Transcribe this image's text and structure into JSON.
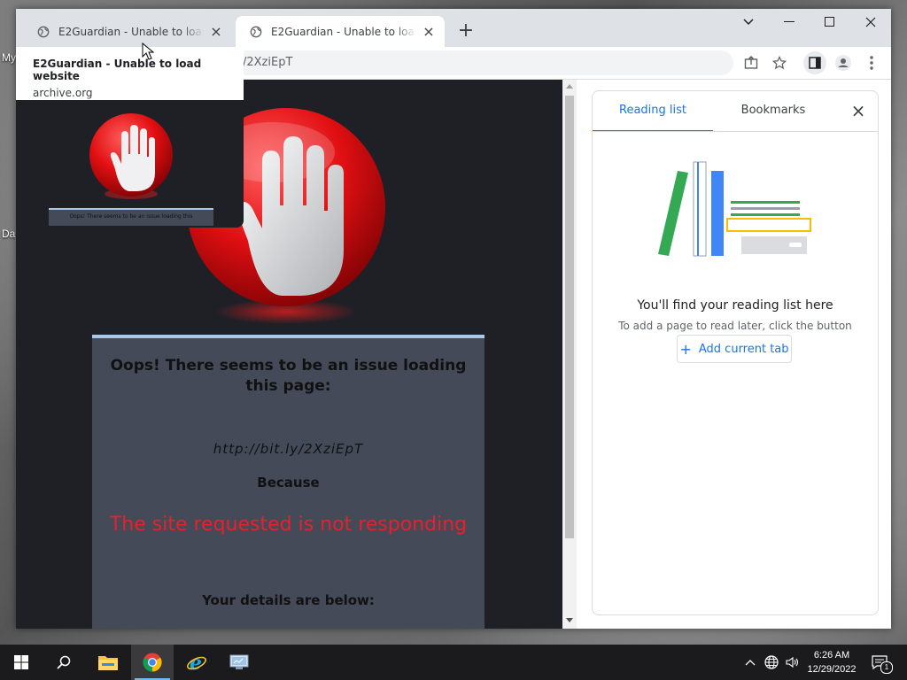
{
  "desktop": {
    "labels": [
      "My",
      "Da"
    ]
  },
  "browser": {
    "tabs": [
      {
        "title": "E2Guardian - Unable to load website",
        "active": false
      },
      {
        "title": "E2Guardian - Unable to load website",
        "active": true
      }
    ],
    "new_tab": "+",
    "address": "/2XziEpT"
  },
  "hover_card": {
    "title": "E2Guardian - Unable to load website",
    "domain": "archive.org",
    "preview_text": "Oops! There seems to be an issue loading this"
  },
  "page": {
    "headline": "Oops! There seems to be an issue loading this page:",
    "url": "http://bit.ly/2XziEpT",
    "because": "Because",
    "reason": "The site requested is not responding",
    "details": "Your details are below:",
    "reason_color": "#e8202b",
    "background_color": "#1f2026",
    "box_color": "#444a58"
  },
  "side_panel": {
    "tabs": [
      "Reading list",
      "Bookmarks"
    ],
    "empty_title": "You'll find your reading list here",
    "empty_subtitle": "To add a page to read later, click the button",
    "add_button": "Add current tab",
    "accent_color": "#1a73e8"
  },
  "taskbar": {
    "time": "6:26 AM",
    "date": "12/29/2022",
    "notification_count": "1",
    "apps": [
      "start-icon",
      "search-icon",
      "file-explorer-icon",
      "chrome-icon",
      "internet-explorer-icon",
      "server-manager-icon"
    ]
  }
}
